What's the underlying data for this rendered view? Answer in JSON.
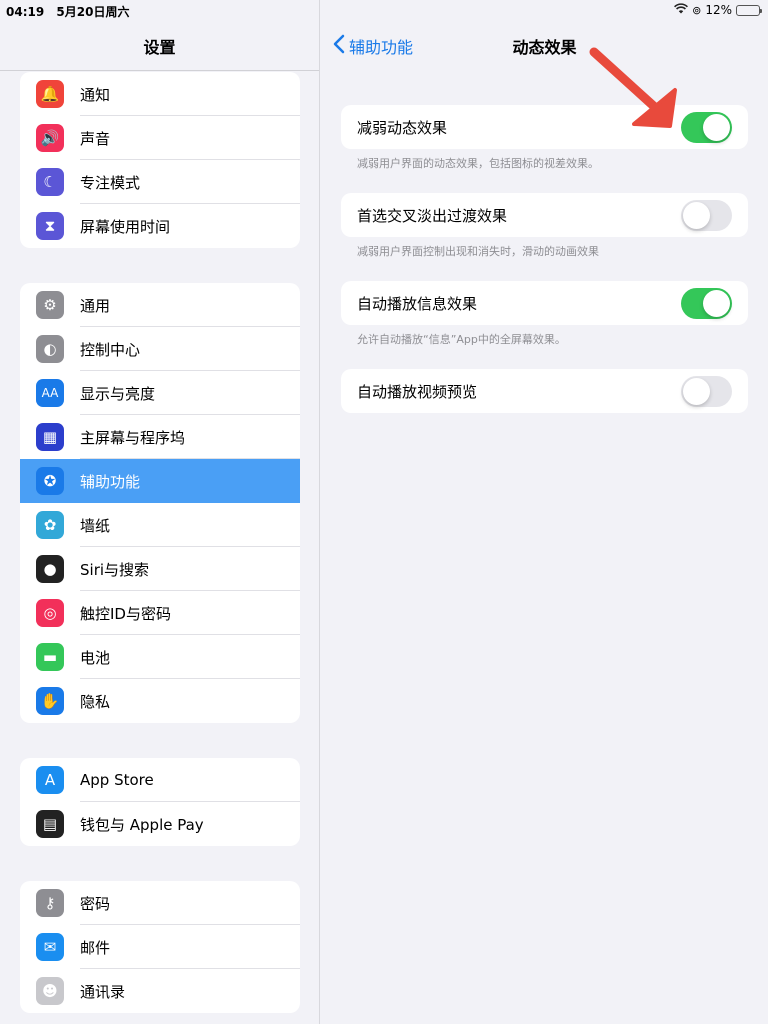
{
  "status": {
    "time": "04:19",
    "date": "5月20日周六",
    "battery": "12%",
    "battery_level": 0.12
  },
  "sidebar": {
    "title": "设置",
    "groups": [
      [
        {
          "label": "通知",
          "icon": "bell-icon",
          "color": "#f0443a"
        },
        {
          "label": "声音",
          "icon": "speaker-icon",
          "color": "#f2305a"
        },
        {
          "label": "专注模式",
          "icon": "moon-icon",
          "color": "#5b56d6"
        },
        {
          "label": "屏幕使用时间",
          "icon": "hourglass-icon",
          "color": "#5b56d6"
        }
      ],
      [
        {
          "label": "通用",
          "icon": "gear-icon",
          "color": "#8e8e93"
        },
        {
          "label": "控制中心",
          "icon": "toggles-icon",
          "color": "#8e8e93"
        },
        {
          "label": "显示与亮度",
          "icon": "text-size-icon",
          "color": "#1a7ae8"
        },
        {
          "label": "主屏幕与程序坞",
          "icon": "grid-icon",
          "color": "#2c3ecc"
        },
        {
          "label": "辅助功能",
          "icon": "accessibility-icon",
          "color": "#1a7ae8",
          "selected": true
        },
        {
          "label": "墙纸",
          "icon": "flower-icon",
          "color": "#32a8d8"
        },
        {
          "label": "Siri与搜索",
          "icon": "siri-icon",
          "color": "#222222"
        },
        {
          "label": "触控ID与密码",
          "icon": "fingerprint-icon",
          "color": "#f2305a"
        },
        {
          "label": "电池",
          "icon": "battery-icon",
          "color": "#34c759"
        },
        {
          "label": "隐私",
          "icon": "hand-icon",
          "color": "#1a7ae8"
        }
      ],
      [
        {
          "label": "App Store",
          "icon": "app-store-icon",
          "color": "#1a8ef0"
        },
        {
          "label": "钱包与 Apple Pay",
          "icon": "wallet-icon",
          "color": "#222222"
        }
      ],
      [
        {
          "label": "密码",
          "icon": "key-icon",
          "color": "#8e8e93"
        },
        {
          "label": "邮件",
          "icon": "mail-icon",
          "color": "#1a8ef0"
        },
        {
          "label": "通讯录",
          "icon": "contacts-icon",
          "color": "#c8c8cc"
        }
      ]
    ]
  },
  "detail": {
    "back_label": "辅助功能",
    "title": "动态效果",
    "settings": [
      {
        "label": "减弱动态效果",
        "on": true,
        "note": "减弱用户界面的动态效果，包括图标的视差效果。"
      },
      {
        "label": "首选交叉淡出过渡效果",
        "on": false,
        "note": "减弱用户界面控制出现和消失时，滑动的动画效果"
      },
      {
        "label": "自动播放信息效果",
        "on": true,
        "note": "允许自动播放“信息”App中的全屏幕效果。"
      },
      {
        "label": "自动播放视频预览",
        "on": false,
        "note": ""
      }
    ]
  },
  "colors": {
    "accent": "#1a7ae8",
    "toggle_on": "#34c759",
    "selected_row": "#4a9ff5",
    "arrow": "#e84a3c"
  }
}
